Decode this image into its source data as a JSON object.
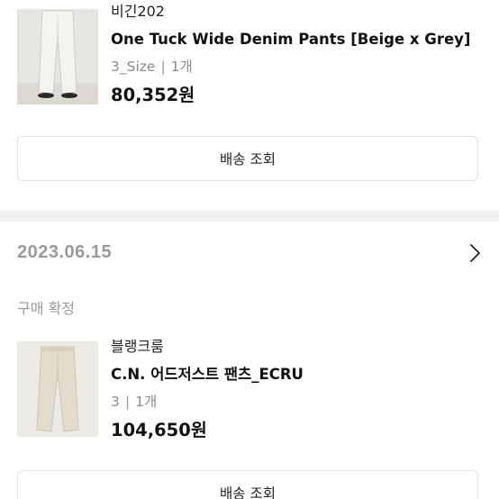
{
  "orders": [
    {
      "brand": "비긴202",
      "product_name": "One Tuck Wide Denim Pants [Beige x Grey]",
      "option": "3_Size",
      "quantity": "1개",
      "price": "80,352원",
      "ship_button": "배송 조회"
    },
    {
      "date": "2023.06.15",
      "status": "구매 확정",
      "brand": "블랭크룸",
      "product_name": "C.N. 어드저스트 팬츠_ECRU",
      "option": "3",
      "quantity": "1개",
      "price": "104,650원",
      "ship_button": "배송 조회"
    }
  ],
  "separator": "|",
  "icons": {
    "order_detail": "chevron-right-icon"
  },
  "colors": {
    "muted": "#9a9a9a",
    "divider": "#f1f1f1",
    "border": "#e3e3e3"
  }
}
